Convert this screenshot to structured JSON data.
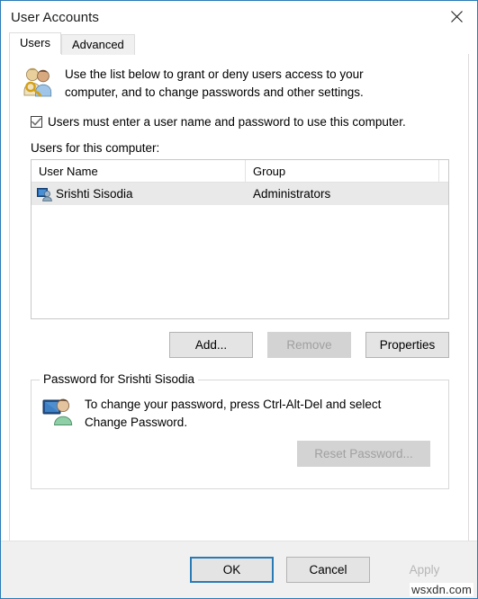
{
  "window": {
    "title": "User Accounts",
    "close_icon": "close-icon",
    "border_color": "#2a7bb5"
  },
  "tabs": [
    {
      "label": "Users",
      "selected": true
    },
    {
      "label": "Advanced",
      "selected": false
    }
  ],
  "header": {
    "icon": "users-with-key-icon",
    "line1": "Use the list below to grant or deny users access to your",
    "line2": "computer, and to change passwords and other settings."
  },
  "checkbox": {
    "checked": true,
    "label": "Users must enter a user name and password to use this computer."
  },
  "list": {
    "label": "Users for this computer:",
    "columns": [
      "User Name",
      "Group"
    ],
    "rows": [
      {
        "icon": "user-account-icon",
        "user_name": "Srishti Sisodia",
        "group": "Administrators",
        "selected": true
      }
    ]
  },
  "list_buttons": [
    {
      "label": "Add...",
      "disabled": false,
      "name": "add-button"
    },
    {
      "label": "Remove",
      "disabled": true,
      "name": "remove-button"
    },
    {
      "label": "Properties",
      "disabled": false,
      "name": "properties-button"
    }
  ],
  "password_group": {
    "title": "Password for Srishti Sisodia",
    "icon": "user-monitor-icon",
    "line1": "To change your password, press Ctrl-Alt-Del and select",
    "line2": "Change Password.",
    "reset_button": {
      "label": "Reset Password...",
      "disabled": true
    }
  },
  "dialog_buttons": [
    {
      "label": "OK",
      "disabled": false,
      "default": true,
      "name": "ok-button"
    },
    {
      "label": "Cancel",
      "disabled": false,
      "default": false,
      "name": "cancel-button"
    },
    {
      "label": "Apply",
      "disabled": true,
      "default": false,
      "name": "apply-button"
    }
  ],
  "watermark": "wsxdn.com"
}
